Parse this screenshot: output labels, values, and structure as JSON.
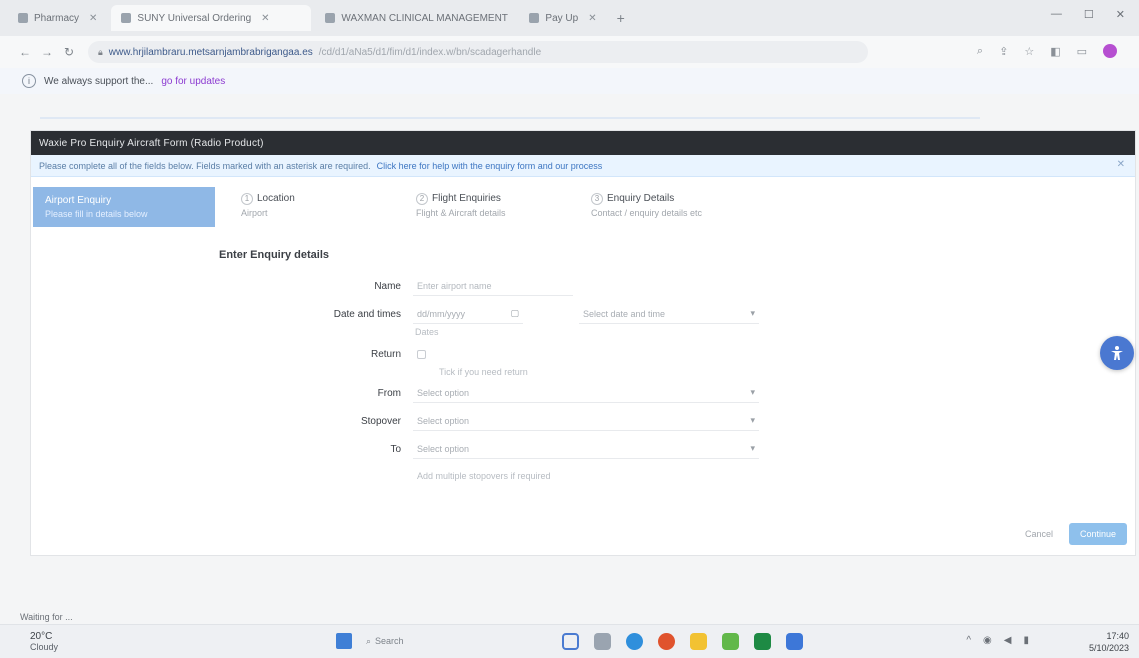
{
  "browser": {
    "tabs": [
      {
        "label": "Pharmacy",
        "active": false
      },
      {
        "label": "SUNY Universal Ordering",
        "active": true
      },
      {
        "label": "WAXMAN CLINICAL MANAGEMENT",
        "active": false
      },
      {
        "label": "Pay Up",
        "active": false
      }
    ],
    "new_tab_symbol": "+",
    "url_host": "www.hrjilambraru.metsarnjambrabrigangaa.es",
    "url_path": "/cd/d1/aNa5/d1/fim/d1/index.w/bn/scadagerhandle",
    "window_controls": [
      "—",
      "☐",
      "✕"
    ]
  },
  "infobar": {
    "text": "We always support the...",
    "link_text": "go for updates"
  },
  "app": {
    "header_title": "Waxie Pro Enquiry Aircraft Form (Radio Product)",
    "notice_text": "Please complete all of the fields below. Fields marked with an asterisk are required.",
    "notice_link": "Click here for help with the enquiry form and our process",
    "sidebar_step": {
      "title": "Airport Enquiry",
      "subtitle": "Please fill in details below"
    },
    "steps": [
      {
        "number": "1",
        "title": "Location",
        "subtitle": "Airport"
      },
      {
        "number": "2",
        "title": "Flight Enquiries",
        "subtitle": "Flight & Aircraft details"
      },
      {
        "number": "3",
        "title": "Enquiry Details",
        "subtitle": "Contact / enquiry details etc"
      }
    ],
    "section_title": "Enter Enquiry details",
    "fields": {
      "name_label": "Name",
      "name_placeholder": "Enter airport name",
      "dates_label": "Date and times",
      "date_from_placeholder": "dd/mm/yyyy",
      "date_to_placeholder": "Select date and time",
      "dates_helper": "Dates",
      "return_label": "Return",
      "return_helper": "Tick if you need return",
      "from_label": "From",
      "from_placeholder": "Select option",
      "via_label": "Stopover",
      "via_placeholder": "Select option",
      "to_label": "To",
      "to_placeholder": "Select option",
      "to_helper": "Add multiple stopovers if required"
    },
    "cancel_label": "Cancel",
    "continue_label": "Continue"
  },
  "status_text": "Waiting for ...",
  "taskbar": {
    "weather_temp": "20°C",
    "weather_desc": "Cloudy",
    "search_label": "Search",
    "time": "17:40",
    "date": "5/10/2023",
    "app_colors": [
      "#4a7bd1",
      "#9aa4b0",
      "#2f8fdc",
      "#e0532d",
      "#f2c232",
      "#62b84a",
      "#1e8a44",
      "#3d77d8"
    ]
  },
  "colors": {
    "header_bg": "#2b2e33",
    "accent": "#8fb8e6",
    "fab": "#4a78d1"
  }
}
